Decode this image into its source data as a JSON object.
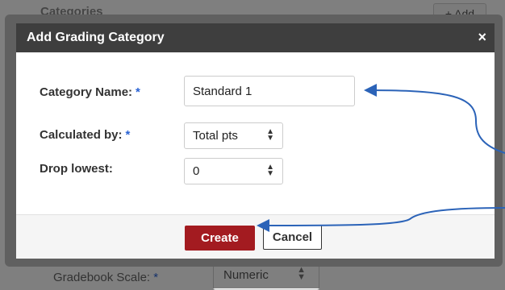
{
  "background": {
    "categories_label": "Categories",
    "add_button_label": "+ Add",
    "gradebook_scale_label": "Gradebook Scale:",
    "gradebook_scale_required": "*",
    "gradebook_scale_value": "Numeric"
  },
  "modal": {
    "title": "Add Grading Category",
    "close_glyph": "×",
    "fields": {
      "category_name": {
        "label": "Category Name:",
        "required": "*",
        "value": "Standard 1"
      },
      "calculated_by": {
        "label": "Calculated by:",
        "required": "*",
        "value": "Total pts"
      },
      "drop_lowest": {
        "label": "Drop lowest:",
        "value": "0"
      }
    },
    "buttons": {
      "create": "Create",
      "cancel": "Cancel"
    }
  },
  "annotations": {
    "arrow_color": "#2b63b8"
  },
  "icons": {
    "select_arrows": "select-arrows-icon",
    "close": "close-icon"
  }
}
